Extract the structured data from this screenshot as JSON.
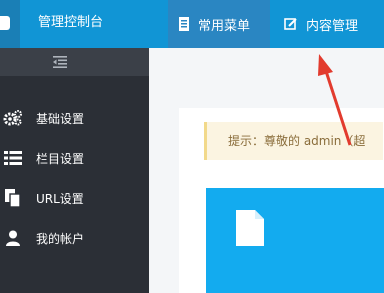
{
  "header": {
    "app_title": "管理控制台",
    "nav": [
      {
        "label": "常用菜单",
        "icon": "book-icon",
        "active": true
      },
      {
        "label": "内容管理",
        "icon": "edit-icon",
        "active": false
      }
    ]
  },
  "sidebar": {
    "toggle_icon": "indent-icon",
    "items": [
      {
        "label": "基础设置",
        "icon": "gears-icon"
      },
      {
        "label": "栏目设置",
        "icon": "list-icon"
      },
      {
        "label": "URL设置",
        "icon": "files-icon"
      },
      {
        "label": "我的帐户",
        "icon": "user-icon"
      }
    ]
  },
  "main": {
    "notice_text": "提示：尊敬的 admin（超",
    "tile_icon": "document-icon"
  },
  "colors": {
    "header": "#1195d5",
    "sidebar": "#2b2f36",
    "tile": "#13abef",
    "arrow": "#e23b2e"
  }
}
